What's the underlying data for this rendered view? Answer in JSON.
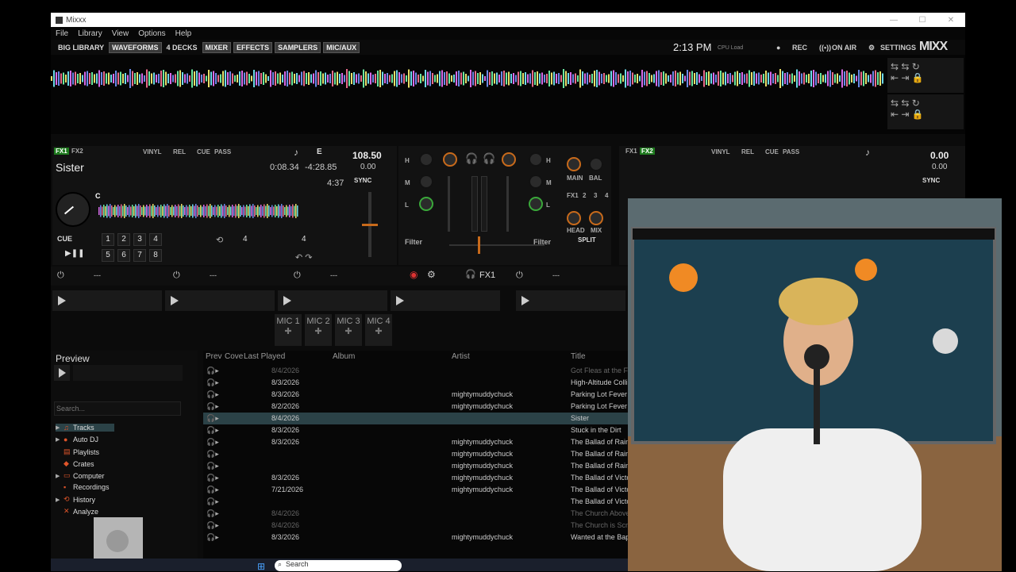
{
  "window": {
    "title": "Mixxx"
  },
  "menu": [
    "File",
    "Library",
    "View",
    "Options",
    "Help"
  ],
  "toolbar": {
    "big_library": "BIG LIBRARY",
    "waveforms": "WAVEFORMS",
    "four_decks": "4 DECKS",
    "mixer": "MIXER",
    "effects": "EFFECTS",
    "samplers": "SAMPLERS",
    "mic_aux": "MIC/AUX",
    "clock": "2:13 PM",
    "cpu": "CPU Load",
    "rec": "REC",
    "on_air": "ON AIR",
    "settings": "SETTINGS",
    "logo": "MIXX"
  },
  "deck1": {
    "fx1": "FX1",
    "fx2": "FX2",
    "vinyl": "VINYL",
    "rel": "REL",
    "cue": "CUE",
    "pass": "PASS",
    "key": "E",
    "bpm": "108.50",
    "rate": "0.00",
    "sync": "SYNC",
    "title": "Sister",
    "elapsed": "0:08.34",
    "remaining": "-4:28.85",
    "duration": "4:37",
    "cue_marker": "C",
    "cue_btn": "CUE",
    "hotcues": [
      "1",
      "2",
      "3",
      "4",
      "5",
      "6",
      "7",
      "8"
    ],
    "loop_size": "4",
    "beatjump": "4"
  },
  "deck2": {
    "fx1": "FX1",
    "fx2": "FX2",
    "vinyl": "VINYL",
    "rel": "REL",
    "cue": "CUE",
    "pass": "PASS",
    "bpm": "0.00",
    "rate": "0.00",
    "sync": "SYNC"
  },
  "mixer": {
    "h": "H",
    "m": "M",
    "l": "L",
    "filter": "Filter",
    "main": "MAIN",
    "bal": "BAL",
    "head": "HEAD",
    "mix": "MIX",
    "split": "SPLIT",
    "fx_nums": [
      "FX1",
      "2",
      "3",
      "4"
    ]
  },
  "fxbar": {
    "fx1": "FX1",
    "slots": [
      "---",
      "---",
      "---",
      "---"
    ]
  },
  "mics": [
    "MIC 1",
    "MIC 2",
    "MIC 3",
    "MIC 4"
  ],
  "library": {
    "preview": "Preview",
    "search_placeholder": "Search...",
    "tree": [
      "Tracks",
      "Auto DJ",
      "Playlists",
      "Crates",
      "Computer",
      "Recordings",
      "History",
      "Analyze"
    ],
    "columns": [
      "Prev",
      "Cove",
      "Last Played",
      "Album",
      "Artist",
      "Title"
    ],
    "rows": [
      {
        "last": "8/4/2026",
        "artist": "",
        "title": "Got Fleas at the Fl",
        "dim": true
      },
      {
        "last": "8/3/2026",
        "artist": "",
        "title": "High-Altitude Colli",
        "dim": false
      },
      {
        "last": "8/3/2026",
        "artist": "mightymuddychuck",
        "title": "Parking Lot Fever",
        "dim": false
      },
      {
        "last": "8/2/2026",
        "artist": "mightymuddychuck",
        "title": "Parking Lot Fever",
        "dim": false
      },
      {
        "last": "8/4/2026",
        "artist": "",
        "title": "Sister",
        "dim": false
      },
      {
        "last": "8/3/2026",
        "artist": "",
        "title": "Stuck in the Dirt",
        "dim": false
      },
      {
        "last": "8/3/2026",
        "artist": "mightymuddychuck",
        "title": "The Ballad of Rain",
        "dim": false
      },
      {
        "last": "",
        "artist": "mightymuddychuck",
        "title": "The Ballad of Rain",
        "dim": false
      },
      {
        "last": "",
        "artist": "mightymuddychuck",
        "title": "The Ballad of Rain",
        "dim": false
      },
      {
        "last": "8/3/2026",
        "artist": "mightymuddychuck",
        "title": "The Ballad of Victo",
        "dim": false
      },
      {
        "last": "7/21/2026",
        "artist": "mightymuddychuck",
        "title": "The Ballad of Victo",
        "dim": false
      },
      {
        "last": "",
        "artist": "",
        "title": "The Ballad of Victo",
        "dim": false
      },
      {
        "last": "8/4/2026",
        "artist": "",
        "title": "The Church Above",
        "dim": true
      },
      {
        "last": "8/4/2026",
        "artist": "",
        "title": "The Church is Scre",
        "dim": true
      },
      {
        "last": "8/3/2026",
        "artist": "mightymuddychuck",
        "title": "Wanted at the Bap",
        "dim": false
      }
    ]
  },
  "taskbar": {
    "search": "Search"
  },
  "colors": {
    "accent_orange": "#c86a1b",
    "fx_green": "#1e7a1e",
    "selected_row": "#2b4247"
  }
}
